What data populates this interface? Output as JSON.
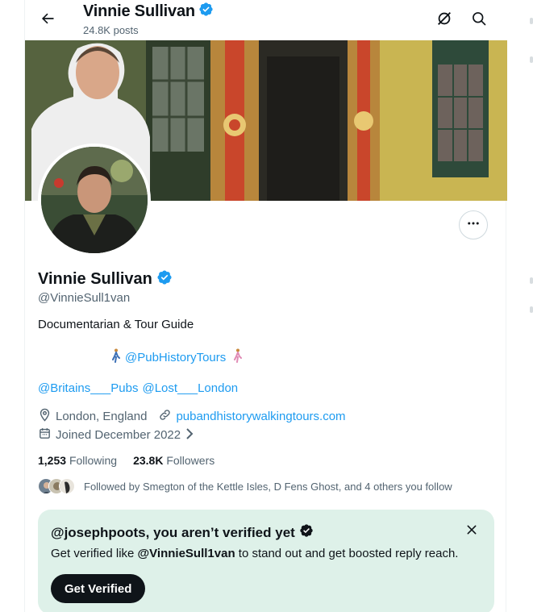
{
  "header": {
    "name": "Vinnie Sullivan",
    "posts_count": "24.8K posts"
  },
  "profile": {
    "name": "Vinnie Sullivan",
    "handle": "@VinnieSull1van",
    "bio_line1": "Documentarian & Tour Guide",
    "bio_line2_link": "@PubHistoryTours",
    "bio_line3_link1": "@Britains___Pubs",
    "bio_line3_link2": "@Lost___London",
    "location": "London, England",
    "website": "pubandhistorywalkingtours.com",
    "joined": "Joined December 2022",
    "following_count": "1,253",
    "following_label": "Following",
    "followers_count": "23.8K",
    "followers_label": "Followers",
    "followed_by": "Followed by Smegton of the Kettle Isles, D Fens Ghost, and 4 others you follow"
  },
  "verify_card": {
    "title": "@josephpoots, you aren’t verified yet",
    "body_prefix": "Get verified like ",
    "body_handle": "@VinnieSull1van",
    "body_suffix": " to stand out and get boosted reply reach.",
    "button": "Get Verified"
  },
  "icons": {
    "back": "arrow-left-icon",
    "verified": "verified-badge-icon",
    "no-grok": "grok-slash-icon",
    "search": "search-icon",
    "more": "more-dots-icon",
    "location": "location-pin-icon",
    "link": "link-icon",
    "calendar": "calendar-icon",
    "close": "close-icon",
    "walking": "person-walking-icon"
  },
  "colors": {
    "accent": "#1d9bf0",
    "text": "#0f1419",
    "muted": "#536471",
    "verify_card_bg": "#def1e9"
  }
}
